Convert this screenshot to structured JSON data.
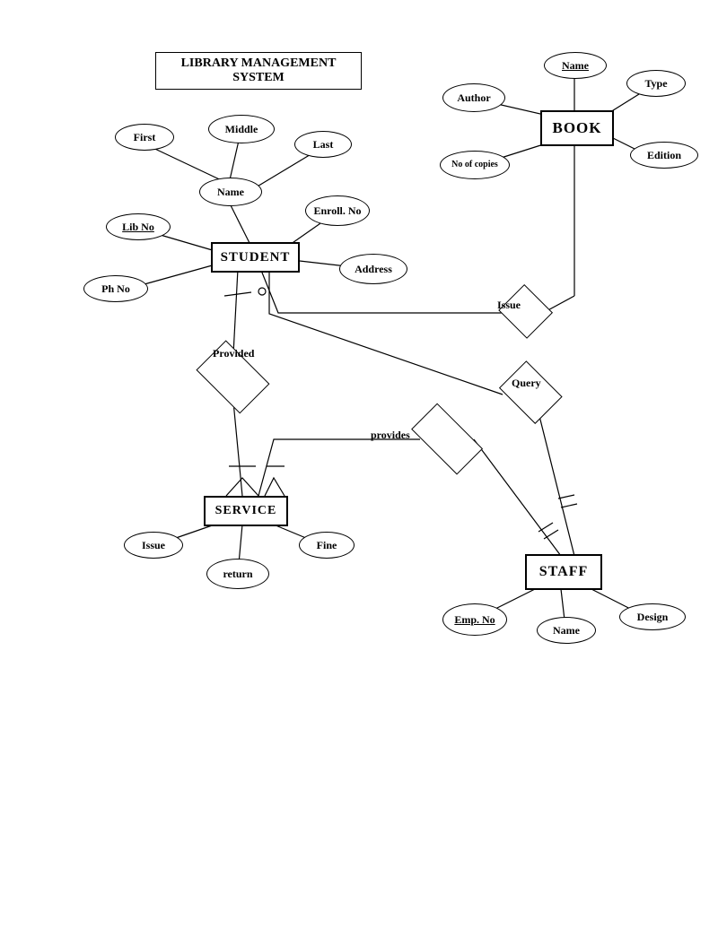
{
  "title": "LIBRARY MANAGEMENT SYSTEM",
  "entities": {
    "student": "STUDENT",
    "book": "BOOK",
    "service": "SERVICE",
    "staff": "STAFF"
  },
  "student_attrs": {
    "name": "Name",
    "first": "First",
    "middle": "Middle",
    "last": "Last",
    "lib_no": "Lib No",
    "ph_no": "Ph No",
    "enroll_no": "Enroll. No",
    "address": "Address"
  },
  "book_attrs": {
    "name": "Name",
    "author": "Author",
    "type": "Type",
    "edition": "Edition",
    "no_of_copies": "No of copies"
  },
  "service_attrs": {
    "issue": "Issue",
    "return": "return",
    "fine": "Fine"
  },
  "staff_attrs": {
    "emp_no": "Emp. No",
    "name": "Name",
    "design": "Design"
  },
  "relationships": {
    "issue": "Issue",
    "provided": "Provided",
    "query": "Query",
    "provides": "provides"
  }
}
